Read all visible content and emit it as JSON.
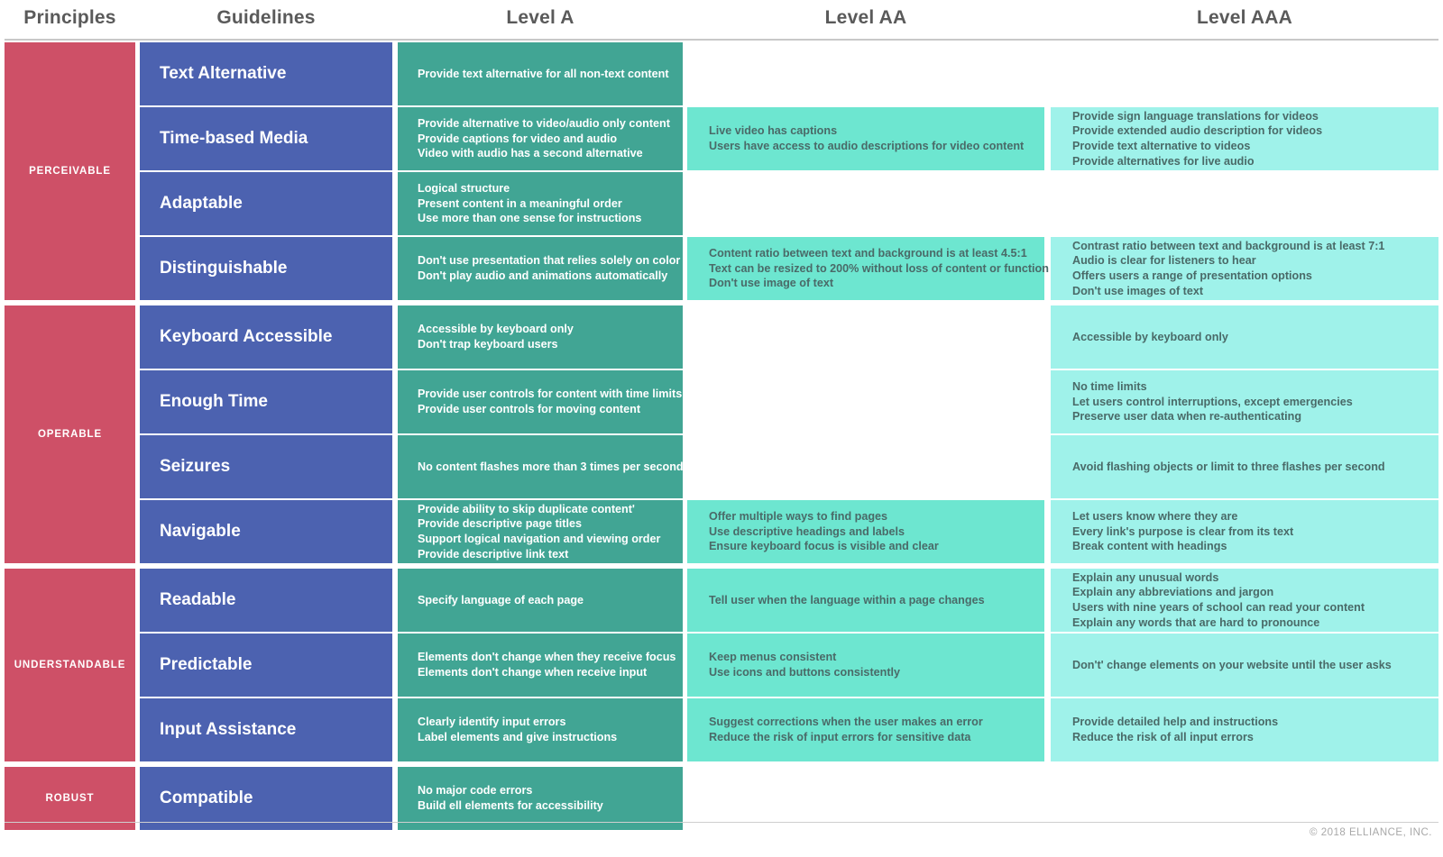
{
  "title": "WCAG Accessibility Principles, Guidelines and Conformance Levels",
  "colors": {
    "principle": "#ce5067",
    "guideline": "#4c62b0",
    "level_a": "#41a594",
    "level_aa": "#6de6d0",
    "level_aaa": "#9ff2ea",
    "header_text": "#5a5a5a",
    "footer_text": "#a8a8a8"
  },
  "headers": [
    {
      "label": "Principles"
    },
    {
      "label": "Guidelines"
    },
    {
      "label": "Level A"
    },
    {
      "label": "Level AA"
    },
    {
      "label": "Level AAA"
    }
  ],
  "footer": {
    "copyright": "© 2018 ELLIANCE, INC."
  },
  "principles": [
    {
      "name": "PERCEIVABLE",
      "guidelines": [
        {
          "name": "Text Alternative",
          "level_a": [
            "Provide text alternative for all non-text content"
          ],
          "level_aa": [],
          "level_aaa": []
        },
        {
          "name": "Time-based Media",
          "level_a": [
            "Provide alternative to video/audio only content",
            "Provide captions for video and audio",
            "Video with audio has a second alternative"
          ],
          "level_aa": [
            "Live video has captions",
            "Users have access to audio descriptions for video content"
          ],
          "level_aaa": [
            "Provide sign language translations for videos",
            "Provide extended audio description for videos",
            "Provide text alternative to videos",
            "Provide alternatives for live audio"
          ]
        },
        {
          "name": "Adaptable",
          "level_a": [
            "Logical structure",
            "Present content in a meaningful order",
            "Use more than one sense for instructions"
          ],
          "level_aa": [],
          "level_aaa": []
        },
        {
          "name": "Distinguishable",
          "level_a": [
            "Don't use presentation that relies solely on color",
            "Don't play audio and animations automatically"
          ],
          "level_aa": [
            "Content ratio between text and background is at least 4.5:1",
            "Text can be resized to 200% without loss of content or function",
            "Don't use image of text"
          ],
          "level_aaa": [
            "Contrast ratio between text and background is at least 7:1",
            "Audio is clear for listeners to hear",
            "Offers users a range of presentation options",
            "Don't use images of text"
          ]
        }
      ]
    },
    {
      "name": "OPERABLE",
      "guidelines": [
        {
          "name": "Keyboard Accessible",
          "level_a": [
            "Accessible by keyboard only",
            "Don't trap keyboard users"
          ],
          "level_aa": [],
          "level_aaa": [
            "Accessible by keyboard only"
          ]
        },
        {
          "name": "Enough Time",
          "level_a": [
            "Provide user controls for content with time limits",
            "Provide user controls for moving content"
          ],
          "level_aa": [],
          "level_aaa": [
            "No time limits",
            "Let users control interruptions, except emergencies",
            "Preserve user data when re-authenticating"
          ]
        },
        {
          "name": "Seizures",
          "level_a": [
            "No content flashes more than 3 times per second"
          ],
          "level_aa": [],
          "level_aaa": [
            "Avoid flashing objects or limit to three flashes per second"
          ]
        },
        {
          "name": "Navigable",
          "level_a": [
            "Provide ability to skip duplicate content'",
            "Provide descriptive page titles",
            "Support logical navigation and viewing order",
            "Provide descriptive link text"
          ],
          "level_aa": [
            "Offer multiple ways to find pages",
            "Use descriptive headings and labels",
            "Ensure keyboard focus is visible and clear"
          ],
          "level_aaa": [
            "Let users know where they are",
            "Every link's purpose is clear from its text",
            "Break content with headings"
          ]
        }
      ]
    },
    {
      "name": "UNDERSTANDABLE",
      "guidelines": [
        {
          "name": "Readable",
          "level_a": [
            "Specify language of each page"
          ],
          "level_aa": [
            "Tell user when the language within a page changes"
          ],
          "level_aaa": [
            "Explain any unusual words",
            "Explain any abbreviations and jargon",
            "Users with nine years of school can read your content",
            "Explain any words that are hard to pronounce"
          ]
        },
        {
          "name": "Predictable",
          "level_a": [
            "Elements don't change when they receive focus",
            "Elements don't change when receive input"
          ],
          "level_aa": [
            "Keep menus consistent",
            "Use icons and buttons consistently"
          ],
          "level_aaa": [
            "Don't' change elements on your website until the user asks"
          ]
        },
        {
          "name": "Input Assistance",
          "level_a": [
            "Clearly identify input errors",
            "Label elements and give instructions"
          ],
          "level_aa": [
            "Suggest corrections when the user makes an error",
            "Reduce the risk of input errors for sensitive data"
          ],
          "level_aaa": [
            "Provide detailed help and instructions",
            "Reduce the risk of all input errors"
          ]
        }
      ]
    },
    {
      "name": "ROBUST",
      "guidelines": [
        {
          "name": "Compatible",
          "level_a": [
            "No major code errors",
            "Build ell elements for accessibility"
          ],
          "level_aa": [],
          "level_aaa": []
        }
      ]
    }
  ]
}
